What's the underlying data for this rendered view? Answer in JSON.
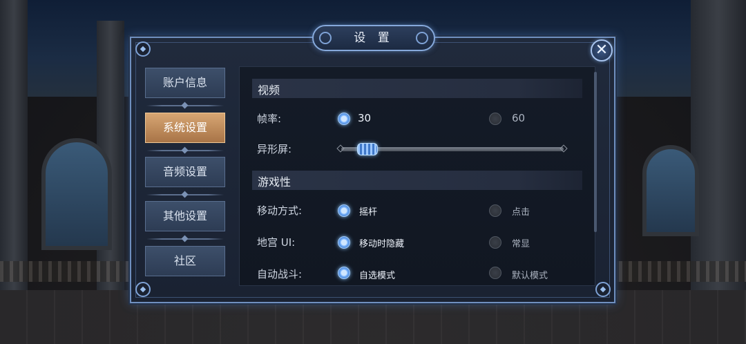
{
  "dialog": {
    "title": "设 置"
  },
  "sidebar": {
    "items": [
      {
        "label": "账户信息"
      },
      {
        "label": "系统设置",
        "active": true
      },
      {
        "label": "音频设置"
      },
      {
        "label": "其他设置"
      },
      {
        "label": "社区"
      }
    ]
  },
  "video": {
    "header": "视频",
    "framerate": {
      "label": "帧率:",
      "options": [
        "30",
        "60"
      ],
      "selected": "30"
    },
    "notch": {
      "label": "异形屏:",
      "value": 0.08
    }
  },
  "gameplay": {
    "header": "游戏性",
    "movement": {
      "label": "移动方式:",
      "options": [
        "摇杆",
        "点击"
      ],
      "selected": "摇杆"
    },
    "dungeon_ui": {
      "label": "地宫 UI:",
      "options": [
        "移动时隐藏",
        "常显"
      ],
      "selected": "移动时隐藏"
    },
    "auto_battle": {
      "label": "自动战斗:",
      "options": [
        "自选模式",
        "默认模式"
      ],
      "selected": "自选模式"
    }
  },
  "colors": {
    "accent": "#5f9ff0",
    "active_tab": "#c48f5d",
    "frame": "#6f8fbf"
  },
  "icons": {
    "close": "close-icon"
  }
}
